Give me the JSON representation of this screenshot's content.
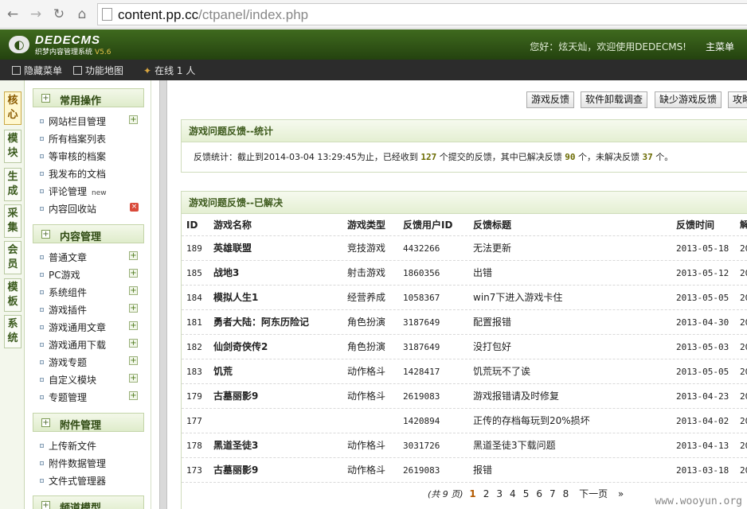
{
  "browser": {
    "url_host": "content.pp.cc",
    "url_path": "/ctpanel/index.php"
  },
  "header": {
    "logo_title": "DEDECMS",
    "logo_sub": "织梦内容管理系统",
    "version": "V5.6",
    "greeting": "您好：炫天灿，欢迎使用DEDECMS!",
    "main_menu": "主菜单"
  },
  "toolbar": {
    "hide_menu": "隐藏菜单",
    "func_map": "功能地图",
    "online": "在线 1 人"
  },
  "vtabs": [
    "核心",
    "模块",
    "生成",
    "采集",
    "会员",
    "模板",
    "系统"
  ],
  "sidebar": {
    "sections": [
      {
        "title": "常用操作",
        "items": [
          "网站栏目管理",
          "所有档案列表",
          "等审核的档案",
          "我发布的文档",
          "评论管理",
          "内容回收站"
        ]
      },
      {
        "title": "内容管理",
        "items": [
          "普通文章",
          "PC游戏",
          "系统组件",
          "游戏插件",
          "游戏通用文章",
          "游戏通用下载",
          "游戏专题",
          "自定义模块",
          "专题管理"
        ]
      },
      {
        "title": "附件管理",
        "items": [
          "上传新文件",
          "附件数据管理",
          "文件式管理器"
        ]
      },
      {
        "title": "频道模型",
        "items": []
      }
    ],
    "new_tag": "new"
  },
  "main": {
    "top_buttons": [
      "游戏反馈",
      "软件卸载调查",
      "缺少游戏反馈",
      "攻略"
    ],
    "stats_panel": {
      "title": "游戏问题反馈--统计",
      "prefix": "反馈统计：截止到2014-03-04 13:29:45为止，已经收到",
      "total": "127",
      "mid1": "个提交的反馈，其中已解决反馈",
      "solved": "90",
      "mid2": "个，未解决反馈",
      "unsolved": "37",
      "suffix": "个。"
    },
    "resolved_panel": {
      "title": "游戏问题反馈--已解决",
      "columns": [
        "ID",
        "游戏名称",
        "游戏类型",
        "反馈用户ID",
        "反馈标题",
        "反馈时间",
        "解"
      ],
      "rows": [
        {
          "id": "189",
          "name": "英雄联盟",
          "type": "竞技游戏",
          "uid": "4432266",
          "title": "无法更新",
          "time": "2013-05-18",
          "extra": "20"
        },
        {
          "id": "185",
          "name": "战地3",
          "type": "射击游戏",
          "uid": "1860356",
          "title": "出错",
          "time": "2013-05-12",
          "extra": "20"
        },
        {
          "id": "184",
          "name": "模拟人生1",
          "type": "经营养成",
          "uid": "1058367",
          "title": "win7下进入游戏卡住",
          "time": "2013-05-05",
          "extra": "20"
        },
        {
          "id": "181",
          "name": "勇者大陆：阿东历险记",
          "type": "角色扮演",
          "uid": "3187649",
          "title": "配置报错",
          "time": "2013-04-30",
          "extra": "20"
        },
        {
          "id": "182",
          "name": "仙剑奇侠传2",
          "type": "角色扮演",
          "uid": "3187649",
          "title": "没打包好",
          "time": "2013-05-03",
          "extra": "20"
        },
        {
          "id": "183",
          "name": "饥荒",
          "type": "动作格斗",
          "uid": "1428417",
          "title": "饥荒玩不了诶",
          "time": "2013-05-05",
          "extra": "20"
        },
        {
          "id": "179",
          "name": "古墓丽影9",
          "type": "动作格斗",
          "uid": "2619083",
          "title": "游戏报错请及时修复",
          "time": "2013-04-23",
          "extra": "20"
        },
        {
          "id": "177",
          "name": "",
          "type": "",
          "uid": "1420894",
          "title": "正传的存档每玩到20%损坏",
          "time": "2013-04-02",
          "extra": "20"
        },
        {
          "id": "178",
          "name": "黑道圣徒3",
          "type": "动作格斗",
          "uid": "3031726",
          "title": "黑道圣徒3下载问题",
          "time": "2013-04-13",
          "extra": "20"
        },
        {
          "id": "173",
          "name": "古墓丽影9",
          "type": "动作格斗",
          "uid": "2619083",
          "title": "报错",
          "time": "2013-03-18",
          "extra": "20"
        }
      ]
    },
    "pager": {
      "info": "(共 9 页)",
      "pages": [
        "1",
        "2",
        "3",
        "4",
        "5",
        "6",
        "7",
        "8"
      ],
      "current": "1",
      "next": "下一页",
      "last": "»"
    }
  },
  "watermark": "www.wooyun.org",
  "colors": {
    "header_green": "#2d5012",
    "panel_title": "#3d5a1c",
    "number_highlight": "#6a6a00"
  }
}
